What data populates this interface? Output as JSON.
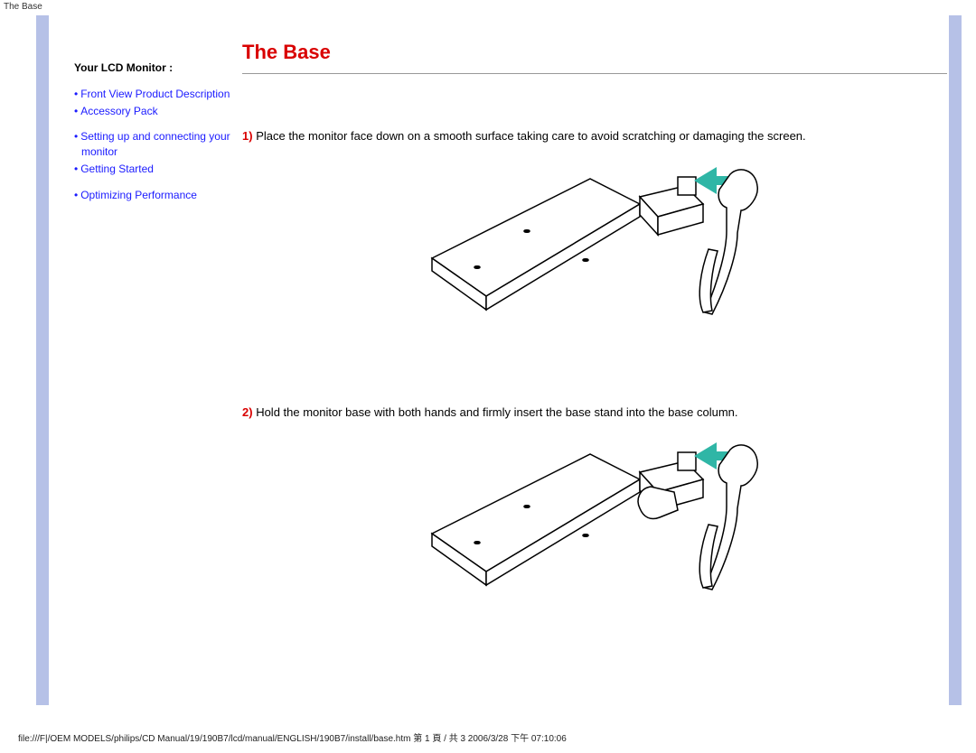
{
  "header": {
    "tab": "The Base"
  },
  "sidebar": {
    "title": "Your LCD Monitor :",
    "group1": [
      {
        "label": "Front View Product Description"
      },
      {
        "label": "Accessory Pack"
      }
    ],
    "group2": [
      {
        "label": "Setting up and connecting your monitor"
      },
      {
        "label": "Getting Started"
      }
    ],
    "group3": [
      {
        "label": "Optimizing Performance"
      }
    ]
  },
  "main": {
    "title": "The Base",
    "steps": [
      {
        "num": "1)",
        "text": "Place the monitor face down on a smooth surface taking care to avoid scratching or damaging the screen."
      },
      {
        "num": "2)",
        "text": "Hold the monitor base with both hands and firmly insert the base stand into the base column."
      }
    ]
  },
  "footer": {
    "path": "file:///F|/OEM MODELS/philips/CD Manual/19/190B7/lcd/manual/ENGLISH/190B7/install/base.htm 第 1 頁 / 共 3 2006/3/28 下午 07:10:06"
  },
  "colors": {
    "accent_red": "#d90000",
    "link_blue": "#1a1aff",
    "stripe": "#b6c1e7",
    "arrow": "#2fb6a6"
  }
}
